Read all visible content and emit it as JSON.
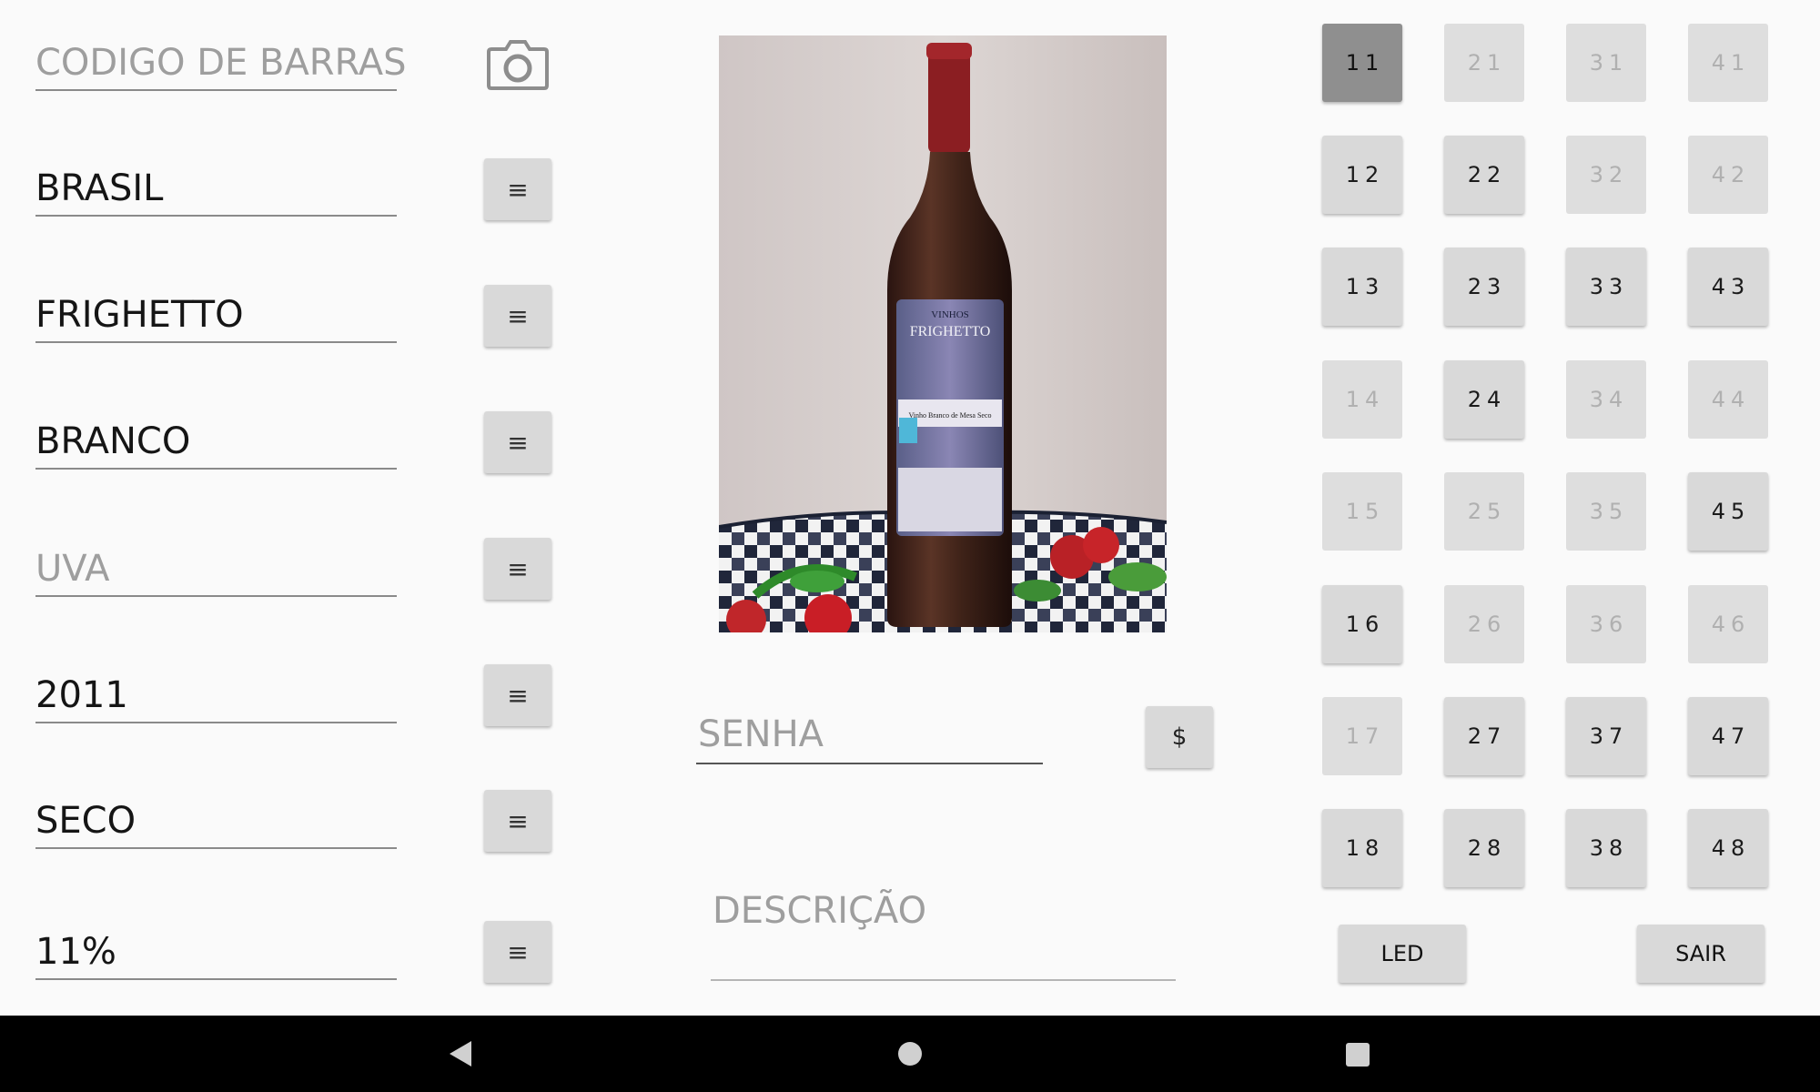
{
  "form": {
    "barcode_hint": "CODIGO DE BARRAS",
    "fields": [
      {
        "id": "pais",
        "value": "BRASIL",
        "is_hint": false
      },
      {
        "id": "marca",
        "value": "FRIGHETTO",
        "is_hint": false
      },
      {
        "id": "tipo",
        "value": "BRANCO",
        "is_hint": false
      },
      {
        "id": "uva",
        "value": "UVA",
        "is_hint": true
      },
      {
        "id": "safra",
        "value": "2011",
        "is_hint": false
      },
      {
        "id": "sabor",
        "value": "SECO",
        "is_hint": false
      },
      {
        "id": "teor",
        "value": "11%",
        "is_hint": false
      }
    ],
    "menu_button_label": "≡"
  },
  "center": {
    "senha_hint": "SENHA",
    "dollar_label": "$",
    "descricao_hint": "DESCRIÇÃO",
    "photo": {
      "label_line1": "VINHOS",
      "label_line2": "FRIGHETTO",
      "label_line3": "Vinho Branco de Mesa Seco"
    }
  },
  "grid": {
    "cells": [
      {
        "label": "11",
        "state": "active"
      },
      {
        "label": "21",
        "state": "disabled"
      },
      {
        "label": "31",
        "state": "disabled"
      },
      {
        "label": "41",
        "state": "disabled"
      },
      {
        "label": "12",
        "state": "enabled"
      },
      {
        "label": "22",
        "state": "enabled"
      },
      {
        "label": "32",
        "state": "disabled"
      },
      {
        "label": "42",
        "state": "disabled"
      },
      {
        "label": "13",
        "state": "enabled"
      },
      {
        "label": "23",
        "state": "enabled"
      },
      {
        "label": "33",
        "state": "enabled"
      },
      {
        "label": "43",
        "state": "enabled"
      },
      {
        "label": "14",
        "state": "disabled"
      },
      {
        "label": "24",
        "state": "enabled"
      },
      {
        "label": "34",
        "state": "disabled"
      },
      {
        "label": "44",
        "state": "disabled"
      },
      {
        "label": "15",
        "state": "disabled"
      },
      {
        "label": "25",
        "state": "disabled"
      },
      {
        "label": "35",
        "state": "disabled"
      },
      {
        "label": "45",
        "state": "enabled"
      },
      {
        "label": "16",
        "state": "enabled"
      },
      {
        "label": "26",
        "state": "disabled"
      },
      {
        "label": "36",
        "state": "disabled"
      },
      {
        "label": "46",
        "state": "disabled"
      },
      {
        "label": "17",
        "state": "disabled"
      },
      {
        "label": "27",
        "state": "enabled"
      },
      {
        "label": "37",
        "state": "enabled"
      },
      {
        "label": "47",
        "state": "enabled"
      },
      {
        "label": "18",
        "state": "enabled"
      },
      {
        "label": "28",
        "state": "enabled"
      },
      {
        "label": "38",
        "state": "enabled"
      },
      {
        "label": "48",
        "state": "enabled"
      }
    ],
    "led_label": "LED",
    "sair_label": "SAIR"
  },
  "navbar": {
    "back_icon": "triangle-back-icon",
    "home_icon": "circle-home-icon",
    "recents_icon": "square-recents-icon"
  }
}
